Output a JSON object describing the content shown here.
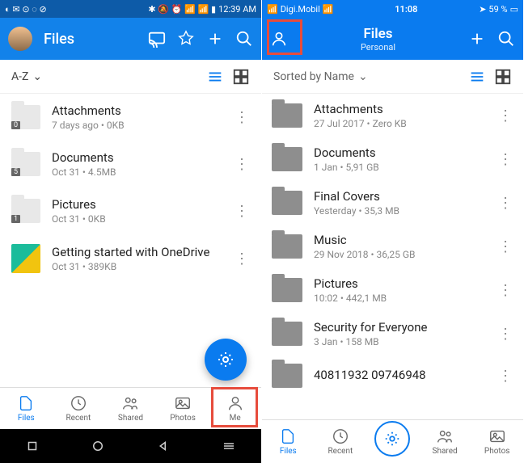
{
  "android": {
    "status": {
      "time": "12:39 AM"
    },
    "header": {
      "title": "Files"
    },
    "sort": {
      "label": "A-Z"
    },
    "items": [
      {
        "name": "Attachments",
        "sub": "7 days ago • 0KB",
        "badge": "0",
        "kind": "folder"
      },
      {
        "name": "Documents",
        "sub": "Oct 31 • 4.5MB",
        "badge": "5",
        "kind": "folder"
      },
      {
        "name": "Pictures",
        "sub": "Oct 31 • 0KB",
        "badge": "1",
        "kind": "folder"
      },
      {
        "name": "Getting started with OneDrive",
        "sub": "Oct 31 • 389KB",
        "kind": "thumb"
      }
    ],
    "tabs": [
      {
        "label": "Files",
        "active": true
      },
      {
        "label": "Recent"
      },
      {
        "label": "Shared"
      },
      {
        "label": "Photos"
      },
      {
        "label": "Me"
      }
    ]
  },
  "ios": {
    "status": {
      "carrier": "Digi.Mobil",
      "time": "11:08",
      "battery": "59 %"
    },
    "header": {
      "title": "Files",
      "subtitle": "Personal"
    },
    "sort": {
      "label": "Sorted by Name"
    },
    "items": [
      {
        "name": "Attachments",
        "sub": "27 Jul 2017 • Zero KB"
      },
      {
        "name": "Documents",
        "sub": "1 Jan • 5,91 GB"
      },
      {
        "name": "Final Covers",
        "sub": "Yesterday • 35,3 MB"
      },
      {
        "name": "Music",
        "sub": "29 Nov 2018 • 36,25 GB"
      },
      {
        "name": "Pictures",
        "sub": "10:02 • 442,1 MB"
      },
      {
        "name": "Security for Everyone",
        "sub": "3 Jan • 158 MB"
      },
      {
        "name": "40811932          09746948",
        "sub": ""
      }
    ],
    "tabs": [
      {
        "label": "Files",
        "active": true
      },
      {
        "label": "Recent"
      },
      {
        "label": "Shared"
      },
      {
        "label": "Photos"
      }
    ]
  }
}
